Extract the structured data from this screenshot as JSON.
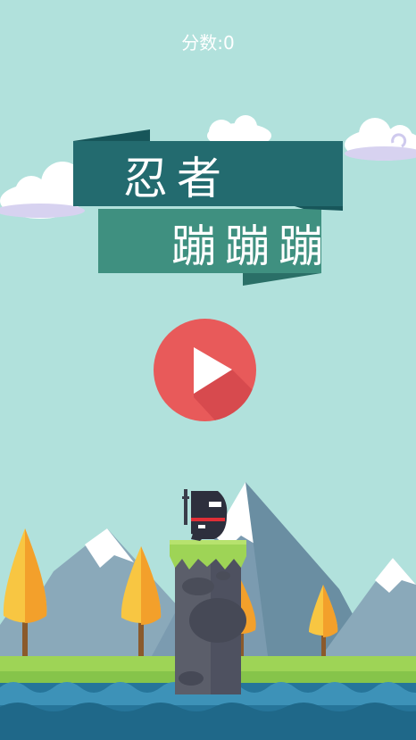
{
  "hud": {
    "score_label": "分数:0"
  },
  "title": {
    "line1": "忍者",
    "line2": "蹦蹦蹦"
  },
  "play_button": {
    "icon": "play-icon"
  },
  "colors": {
    "sky": "#b1e1dc",
    "banner_dark": "#236b6f",
    "banner_light": "#3f9080",
    "play": "#e85a5a",
    "grass": "#9ed456",
    "water": "#26759a"
  }
}
